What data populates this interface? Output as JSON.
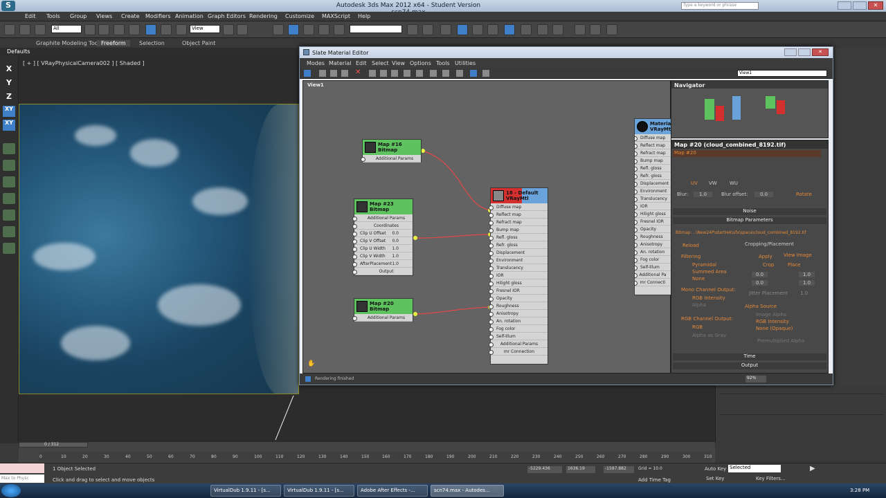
{
  "app": {
    "title": "Autodesk 3ds Max 2012 x64 - Student Version   scn74.max",
    "search_placeholder": "Type a keyword or phrase"
  },
  "menu": [
    "Edit",
    "Tools",
    "Group",
    "Views",
    "Create",
    "Modifiers",
    "Animation",
    "Graph Editors",
    "Rendering",
    "Customize",
    "MAXScript",
    "Help"
  ],
  "toolbar": {
    "selection_filter": "All",
    "ref_coord": "View",
    "named_sel": ""
  },
  "ribbon": [
    "Graphite Modeling Tools",
    "Freeform",
    "Selection",
    "Object Paint"
  ],
  "defaults_label": "Defaults",
  "viewport_label": "[ + ] [ VRayPhysicalCamera002 ] [ Shaded ]",
  "axis_buttons": [
    "X",
    "Y",
    "Z",
    "XY",
    "XY"
  ],
  "sme": {
    "title": "Slate Material Editor",
    "menu": [
      "Modes",
      "Material",
      "Edit",
      "Select",
      "View",
      "Options",
      "Tools",
      "Utilities"
    ],
    "view_dropdown": "View1",
    "view_tab": "View1",
    "status": "Rendering finished",
    "zoom": "92%",
    "nodes": {
      "map16": {
        "title": "Map #16",
        "sub": "Bitmap",
        "slots": [
          "Additional Params"
        ]
      },
      "map23": {
        "title": "Map #23",
        "sub": "Bitmap",
        "slots": [
          "Additional Params",
          "Coordinates"
        ],
        "params": [
          [
            "Clip U Offset",
            "0.0"
          ],
          [
            "Clip V Offset",
            "0.0"
          ],
          [
            "Clip U Width",
            "1.0"
          ],
          [
            "Clip V Width",
            "1.0"
          ],
          [
            "AfterPlacement",
            "1.0"
          ]
        ],
        "out": "Output"
      },
      "map20": {
        "title": "Map #20",
        "sub": "Bitmap",
        "slots": [
          "Additional Params"
        ]
      },
      "mat": {
        "title": "18 - Default",
        "sub": "VRayMtl",
        "slots": [
          "Diffuse map",
          "Reflect map",
          "Refract map",
          "Bump map",
          "Refl. gloss",
          "Refr. gloss",
          "Displacement",
          "Environment",
          "Translucency",
          "IOR",
          "Hilight gloss",
          "Fresnel IOR",
          "Opacity",
          "Roughness",
          "Anisotropy",
          "An. rotation",
          "Fog color",
          "Self-Illum",
          "Additional Params",
          "mr Connection"
        ]
      },
      "mat2": {
        "title": "Material",
        "sub": "VRayMtl",
        "slots": [
          "Diffuse map",
          "Reflect map",
          "Refract map",
          "Bump map",
          "Refl. gloss",
          "Refr. gloss",
          "Displacement",
          "Environment",
          "Translucency",
          "IOR",
          "Hilight gloss",
          "Fresnel IOR",
          "Opacity",
          "Roughness",
          "Anisotropy",
          "An. rotation",
          "Fog color",
          "Self-Illum",
          "Additional Pa",
          "mr Connecti"
        ]
      }
    },
    "navigator": "Navigator",
    "map_panel": {
      "header": "Map #20 (cloud_combined_8192.tif)",
      "field": "Map #20",
      "uv": [
        "UV",
        "VW",
        "WU"
      ],
      "blur_label": "Blur:",
      "blur": "1.0",
      "blur_offset_label": "Blur offset:",
      "blur_offset": "0.0",
      "rotate": "Rotate",
      "sections": [
        "Noise",
        "Bitmap Parameters",
        "Time",
        "Output"
      ],
      "bitmap_path": "Bitmap: ..\\New24P\\startrek\\sfx\\space\\cloud_combined_8192.tif",
      "reload": "Reload",
      "cropping": "Cropping/Placement",
      "apply": "Apply",
      "view_image": "View Image",
      "crop": "Crop",
      "place": "Place",
      "u": "0.0",
      "v": "0.0",
      "w": "1.0",
      "h": "1.0",
      "jitter": "Jitter Placement",
      "jitter_val": "1.0",
      "filtering": "Filtering",
      "filters": [
        "Pyramidal",
        "Summed Area",
        "None"
      ],
      "mono": "Mono Channel Output:",
      "mono_opts": [
        "RGB Intensity",
        "Alpha"
      ],
      "rgb": "RGB Channel Output:",
      "rgb_opts": [
        "RGB",
        "Alpha as Gray"
      ],
      "alpha_src": "Alpha Source",
      "alpha_opts": [
        "Image Alpha",
        "RGB Intensity",
        "None (Opaque)"
      ],
      "premult": "Premultiplied Alpha"
    }
  },
  "timeline": {
    "frame": "0 / 312",
    "ticks": [
      "0",
      "10",
      "20",
      "30",
      "40",
      "50",
      "60",
      "70",
      "80",
      "90",
      "100",
      "110",
      "120",
      "130",
      "140",
      "150",
      "160",
      "170",
      "180",
      "190",
      "200",
      "210",
      "220",
      "230",
      "240",
      "250",
      "260",
      "270",
      "280",
      "290",
      "300",
      "310"
    ]
  },
  "status": {
    "selected": "1 Object Selected",
    "prompt": "Click and drag to select and move objects",
    "maxscript": "Max to Physc",
    "x": "-5229.436",
    "y": "1636.19",
    "z": "-1597.882",
    "grid": "Grid = 10.0",
    "add_time_tag": "Add Time Tag",
    "auto_key": "Auto Key",
    "set_key": "Set Key",
    "key_mode": "Selected",
    "key_filters": "Key Filters..."
  },
  "taskbar": {
    "items": [
      "VirtualDub 1.9.11 - [s...",
      "VirtualDub 1.9.11 - [s...",
      "Adobe After Effects -...",
      "scn74.max - Autodes..."
    ],
    "clock": "3:28 PM"
  },
  "colors": {
    "bitmap_node": "#5ec25e",
    "mtl_node": "#6aa3d9",
    "wire": "#e04848",
    "accent": "#3f7fc8"
  }
}
